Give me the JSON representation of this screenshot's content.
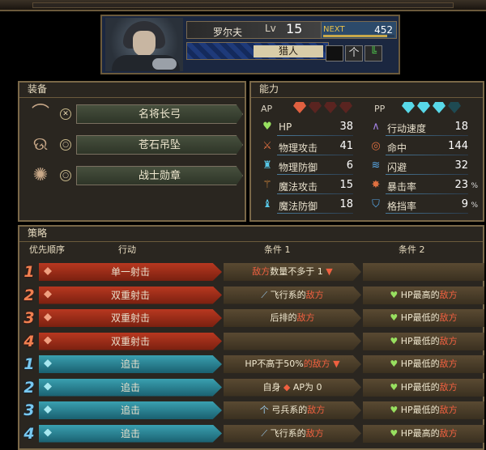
{
  "header": {
    "name": "罗尔夫",
    "lv_label": "Lv",
    "level": "15",
    "next_label": "NEXT",
    "next_value": "452",
    "next_progress": 0.9,
    "class_name": "猎人",
    "weapon_icons": [
      "sword-slot-icon",
      "bow-icon",
      "boot-icon"
    ]
  },
  "equipment": {
    "title": "装备",
    "items": [
      {
        "icon": "bow-icon",
        "slot_icon": "crossed-arrows-icon",
        "name": "名将长弓"
      },
      {
        "icon": "pendant-icon",
        "slot_icon": "ring-icon",
        "name": "苍石吊坠"
      },
      {
        "icon": "medal-icon",
        "slot_icon": "ring-icon",
        "name": "战士勋章"
      }
    ]
  },
  "abilities": {
    "title": "能力",
    "ap_label": "AP",
    "ap_total": 4,
    "ap_filled": 1,
    "pp_label": "PP",
    "pp_total": 4,
    "pp_filled": 3,
    "left": [
      {
        "icon": "heart-icon",
        "label": "HP",
        "value": "38"
      },
      {
        "icon": "sword-icon",
        "label": "物理攻击",
        "value": "41"
      },
      {
        "icon": "armor-icon",
        "label": "物理防御",
        "value": "6"
      },
      {
        "icon": "staff-icon",
        "label": "魔法攻击",
        "value": "15"
      },
      {
        "icon": "robe-icon",
        "label": "魔法防御",
        "value": "18"
      }
    ],
    "right": [
      {
        "icon": "boot-icon",
        "label": "行动速度",
        "value": "18",
        "unit": ""
      },
      {
        "icon": "target-icon",
        "label": "命中",
        "value": "144",
        "unit": ""
      },
      {
        "icon": "dodge-icon",
        "label": "闪避",
        "value": "32",
        "unit": ""
      },
      {
        "icon": "critical-icon",
        "label": "暴击率",
        "value": "23",
        "unit": "%"
      },
      {
        "icon": "shield-icon",
        "label": "格挡率",
        "value": "9",
        "unit": "%"
      }
    ]
  },
  "tactics": {
    "title": "策略",
    "headers": {
      "priority": "优先顺序",
      "action": "行动",
      "cond1": "条件 1",
      "cond2": "条件 2"
    },
    "rows": [
      {
        "num": "1",
        "type": "r",
        "action": "单一射击",
        "c1_icon": "",
        "c1_pre": "",
        "c1_red": "敌方",
        "c1_post": "数量不多于 1",
        "c1_arrow": "▼",
        "c2_heart": "",
        "c2_pre": "",
        "c2_red": ""
      },
      {
        "num": "2",
        "type": "r",
        "action": "双重射击",
        "c1_icon": "feather-icon",
        "c1_pre": "飞行系的",
        "c1_red": "敌方",
        "c1_post": "",
        "c1_arrow": "",
        "c2_heart": "♥",
        "c2_pre": "HP最高的",
        "c2_red": "敌方"
      },
      {
        "num": "3",
        "type": "r",
        "action": "双重射击",
        "c1_icon": "",
        "c1_pre": "后排的",
        "c1_red": "敌方",
        "c1_post": "",
        "c1_arrow": "",
        "c2_heart": "♥",
        "c2_pre": "HP最低的",
        "c2_red": "敌方"
      },
      {
        "num": "4",
        "type": "r",
        "action": "双重射击",
        "c1_icon": "",
        "c1_pre": "",
        "c1_red": "",
        "c1_post": "",
        "c1_arrow": "",
        "c2_heart": "♥",
        "c2_pre": "HP最低的",
        "c2_red": "敌方"
      },
      {
        "num": "1",
        "type": "b",
        "action": "追击",
        "c1_icon": "",
        "c1_pre": "HP不高于50%",
        "c1_red": "的敌方",
        "c1_post": "",
        "c1_arrow": "▼",
        "c2_heart": "♥",
        "c2_pre": "HP最低的",
        "c2_red": "敌方"
      },
      {
        "num": "2",
        "type": "b",
        "action": "追击",
        "c1_icon": "",
        "c1_pre": "自身",
        "c1_red": "",
        "c1_post": "AP为 0",
        "c1_arrow": "◆",
        "c2_heart": "♥",
        "c2_pre": "HP最低的",
        "c2_red": "敌方"
      },
      {
        "num": "3",
        "type": "b",
        "action": "追击",
        "c1_icon": "bow-class-icon",
        "c1_pre": "弓兵系的",
        "c1_red": "敌方",
        "c1_post": "",
        "c1_arrow": "",
        "c2_heart": "♥",
        "c2_pre": "HP最低的",
        "c2_red": "敌方"
      },
      {
        "num": "4",
        "type": "b",
        "action": "追击",
        "c1_icon": "feather-icon",
        "c1_pre": "飞行系的",
        "c1_red": "敌方",
        "c1_post": "",
        "c1_arrow": "",
        "c2_heart": "♥",
        "c2_pre": "HP最高的",
        "c2_red": "敌方"
      }
    ]
  },
  "colors": {
    "red_row": "#b83820",
    "blue_row": "#3aa0b0",
    "enemy_text": "#f06040",
    "heart": "#98e060"
  }
}
